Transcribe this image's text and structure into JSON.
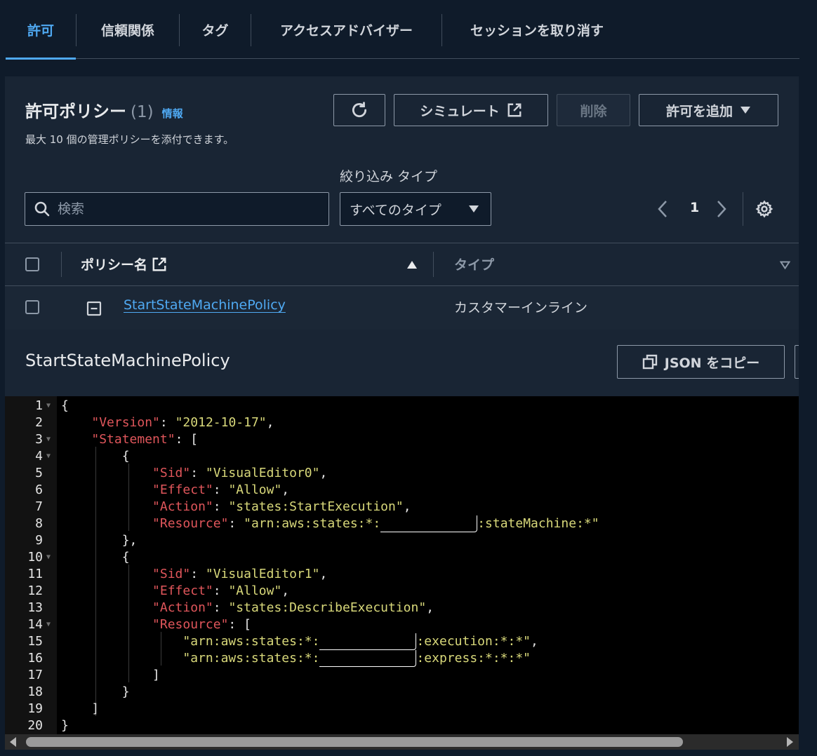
{
  "tabs": [
    {
      "label": "許可",
      "active": true
    },
    {
      "label": "信頼関係"
    },
    {
      "label": "タグ"
    },
    {
      "label": "アクセスアドバイザー"
    },
    {
      "label": "セッションを取り消す"
    }
  ],
  "policies": {
    "title": "許可ポリシー",
    "count": "(1)",
    "info_link": "情報",
    "subtitle": "最大 10 個の管理ポリシーを添付できます。",
    "buttons": {
      "refresh_icon": "refresh-icon",
      "simulate": "シミュレート",
      "delete": "削除",
      "add_permissions": "許可を追加"
    },
    "filter_label": "絞り込み タイプ",
    "search_placeholder": "検索",
    "filter_value": "すべてのタイプ",
    "page": "1"
  },
  "table": {
    "col_name": "ポリシー名",
    "col_type": "タイプ",
    "rows": [
      {
        "name": "StartStateMachinePolicy",
        "type": "カスタマーインライン"
      }
    ]
  },
  "detail": {
    "title": "StartStateMachinePolicy",
    "copy_button": "JSON をコピー"
  },
  "colors": {
    "accent": "#4fa9f2",
    "json_key": "#e0565b",
    "json_string": "#d8d87a"
  },
  "code": {
    "lines": [
      {
        "n": "1",
        "fold": true,
        "t": "{"
      },
      {
        "n": "2",
        "t": "    \"Version\": \"2012-10-17\","
      },
      {
        "n": "3",
        "fold": true,
        "t": "    \"Statement\": ["
      },
      {
        "n": "4",
        "fold": true,
        "t": "        {"
      },
      {
        "n": "5",
        "t": "            \"Sid\": \"VisualEditor0\","
      },
      {
        "n": "6",
        "t": "            \"Effect\": \"Allow\","
      },
      {
        "n": "7",
        "t": "            \"Action\": \"states:StartExecution\","
      },
      {
        "n": "8",
        "t": "            \"Resource\": \"arn:aws:states:*:[R]:stateMachine:*\""
      },
      {
        "n": "9",
        "t": "        },"
      },
      {
        "n": "10",
        "fold": true,
        "t": "        {"
      },
      {
        "n": "11",
        "t": "            \"Sid\": \"VisualEditor1\","
      },
      {
        "n": "12",
        "t": "            \"Effect\": \"Allow\","
      },
      {
        "n": "13",
        "t": "            \"Action\": \"states:DescribeExecution\","
      },
      {
        "n": "14",
        "fold": true,
        "t": "            \"Resource\": ["
      },
      {
        "n": "15",
        "t": "                \"arn:aws:states:*:[R]:execution:*:*\","
      },
      {
        "n": "16",
        "t": "                \"arn:aws:states:*:[R]:express:*:*:*\""
      },
      {
        "n": "17",
        "t": "            ]"
      },
      {
        "n": "18",
        "t": "        }"
      },
      {
        "n": "19",
        "t": "    ]"
      },
      {
        "n": "20",
        "t": "}"
      }
    ]
  }
}
